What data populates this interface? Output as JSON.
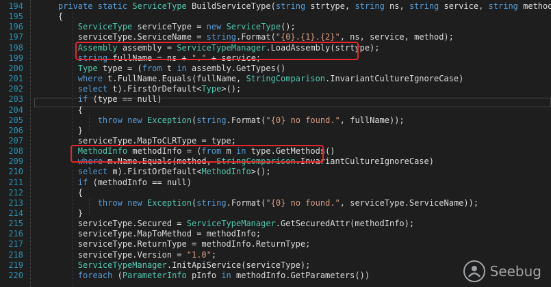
{
  "watermark": "Seebug",
  "lines": [
    {
      "n": "194",
      "t": "    private static ServiceType BuildServiceType(string strtype, string ns, string service, string method)"
    },
    {
      "n": "195",
      "t": "    {"
    },
    {
      "n": "196",
      "t": "        ServiceType serviceType = new ServiceType();"
    },
    {
      "n": "197",
      "t": "        serviceType.ServiceName = string.Format(\"{0}.{1}.{2}\", ns, service, method);"
    },
    {
      "n": "198",
      "t": "        Assembly assembly = ServiceTypeManager.LoadAssembly(strtype);"
    },
    {
      "n": "199",
      "t": "        string fullName = ns + \".\" + service;"
    },
    {
      "n": "200",
      "t": "        Type type = (from t in assembly.GetTypes()"
    },
    {
      "n": "201",
      "t": "        where t.FullName.Equals(fullName, StringComparison.InvariantCultureIgnoreCase)"
    },
    {
      "n": "202",
      "t": "        select t).FirstOrDefault<Type>();"
    },
    {
      "n": "203",
      "t": "        if (type == null)"
    },
    {
      "n": "204",
      "t": "        {"
    },
    {
      "n": "205",
      "t": "            throw new Exception(string.Format(\"{0} no found.\", fullName));"
    },
    {
      "n": "206",
      "t": "        }"
    },
    {
      "n": "207",
      "t": "        serviceType.MapToCLRType = type;"
    },
    {
      "n": "208",
      "t": "        MethodInfo methodInfo = (from m in type.GetMethods()"
    },
    {
      "n": "209",
      "t": "        where m.Name.Equals(method, StringComparison.InvariantCultureIgnoreCase)"
    },
    {
      "n": "210",
      "t": "        select m).FirstOrDefault<MethodInfo>();"
    },
    {
      "n": "211",
      "t": "        if (methodInfo == null)"
    },
    {
      "n": "212",
      "t": "        {"
    },
    {
      "n": "213",
      "t": "            throw new Exception(string.Format(\"{0} no found.\", serviceType.ServiceName));"
    },
    {
      "n": "214",
      "t": "        }"
    },
    {
      "n": "215",
      "t": "        serviceType.Secured = ServiceTypeManager.GetSecuredAttr(methodInfo);"
    },
    {
      "n": "216",
      "t": "        serviceType.MapToMethod = methodInfo;"
    },
    {
      "n": "217",
      "t": "        serviceType.ReturnType = methodInfo.ReturnType;"
    },
    {
      "n": "218",
      "t": "        serviceType.Version = \"1.0\";"
    },
    {
      "n": "219",
      "t": "        ServiceTypeManager.InitApiService(serviceType);"
    },
    {
      "n": "220",
      "t": "        foreach (ParameterInfo pInfo in methodInfo.GetParameters())"
    }
  ]
}
